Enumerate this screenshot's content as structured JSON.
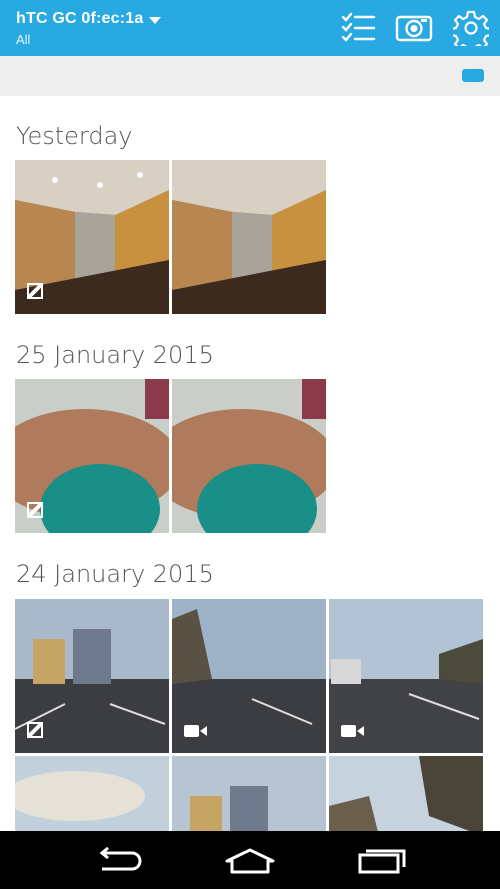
{
  "app_bar": {
    "device_name": "hTC GC 0f:ec:1a",
    "filter": "All",
    "icons": [
      "select-list-icon",
      "camera-icon",
      "settings-icon"
    ],
    "color": "#29a9e1"
  },
  "sections": [
    {
      "title": "Yesterday",
      "items": [
        {
          "type": "photo-pair",
          "scene": "kitchen"
        },
        {
          "type": "photo-pair",
          "scene": "kitchen"
        }
      ]
    },
    {
      "title": "25 January 2015",
      "items": [
        {
          "type": "photo-pair",
          "scene": "hand"
        },
        {
          "type": "photo-pair",
          "scene": "hand"
        }
      ]
    },
    {
      "title": "24 January 2015",
      "items": [
        {
          "type": "photo-pair",
          "scene": "trucks"
        },
        {
          "type": "video",
          "scene": "road"
        },
        {
          "type": "video",
          "scene": "road"
        },
        {
          "type": "image",
          "scene": "sky"
        },
        {
          "type": "image",
          "scene": "trucks"
        },
        {
          "type": "image",
          "scene": "trees"
        }
      ]
    }
  ],
  "nav": [
    "back-icon",
    "home-icon",
    "recent-apps-icon"
  ]
}
